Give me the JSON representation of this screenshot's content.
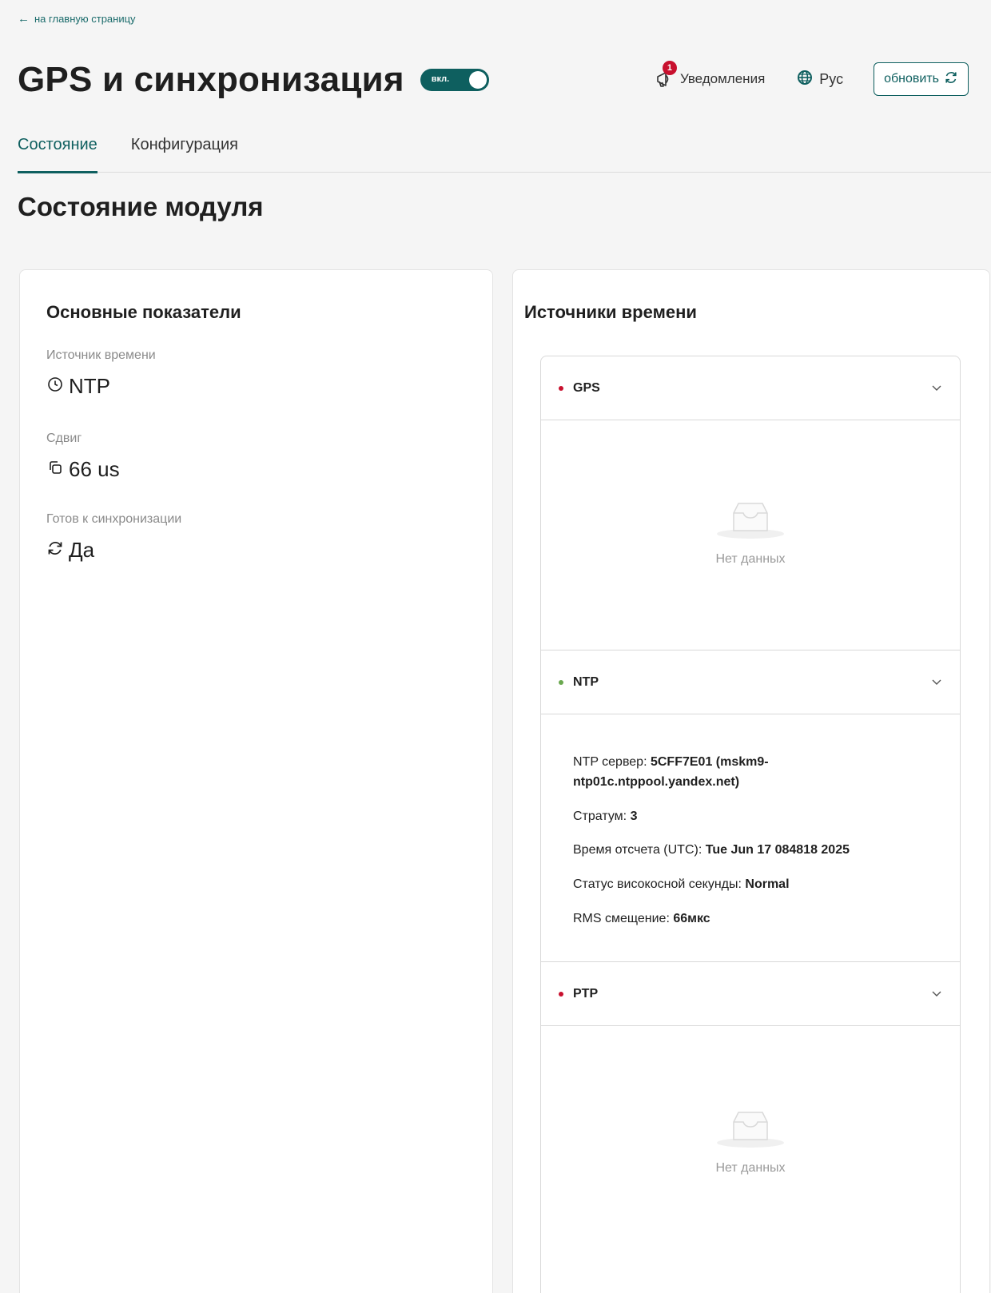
{
  "header": {
    "back_link": "на главную страницу",
    "title": "GPS и синхронизация",
    "toggle_label": "вкл.",
    "notifications_label": "Уведомления",
    "notifications_count": "1",
    "language_label": "Рус",
    "refresh_label": "обновить"
  },
  "tabs": [
    {
      "label": "Состояние",
      "active": true
    },
    {
      "label": "Конфигурация",
      "active": false
    }
  ],
  "section_title": "Состояние модуля",
  "main_metrics": {
    "title": "Основные показатели",
    "items": [
      {
        "label": "Источник времени",
        "value": "NTP",
        "icon": "clock-icon"
      },
      {
        "label": "Сдвиг",
        "value": "66 us",
        "icon": "copy-icon"
      },
      {
        "label": "Готов к синхронизации",
        "value": "Да",
        "icon": "sync-icon"
      }
    ]
  },
  "time_sources": {
    "title": "Источники времени",
    "empty_text": "Нет данных",
    "sources": [
      {
        "name": "GPS",
        "status_color": "#c8102e"
      },
      {
        "name": "NTP",
        "status_color": "#6aa84f"
      },
      {
        "name": "PTP",
        "status_color": "#c8102e"
      }
    ],
    "ntp_details": {
      "server_label": "NTP сервер:",
      "server_value": "5CFF7E01 (mskm9-ntp01c.ntppool.yandex.net)",
      "stratum_label": "Стратум:",
      "stratum_value": "3",
      "ref_time_label": "Время отсчета (UTC):",
      "ref_time_value": "Tue Jun 17 084818 2025",
      "leap_label": "Статус високосной секунды:",
      "leap_value": "Normal",
      "rms_label": "RMS смещение:",
      "rms_value": "66мкс"
    }
  },
  "colors": {
    "accent": "#0e5f5f",
    "alert": "#c8102e",
    "ok": "#6aa84f"
  }
}
